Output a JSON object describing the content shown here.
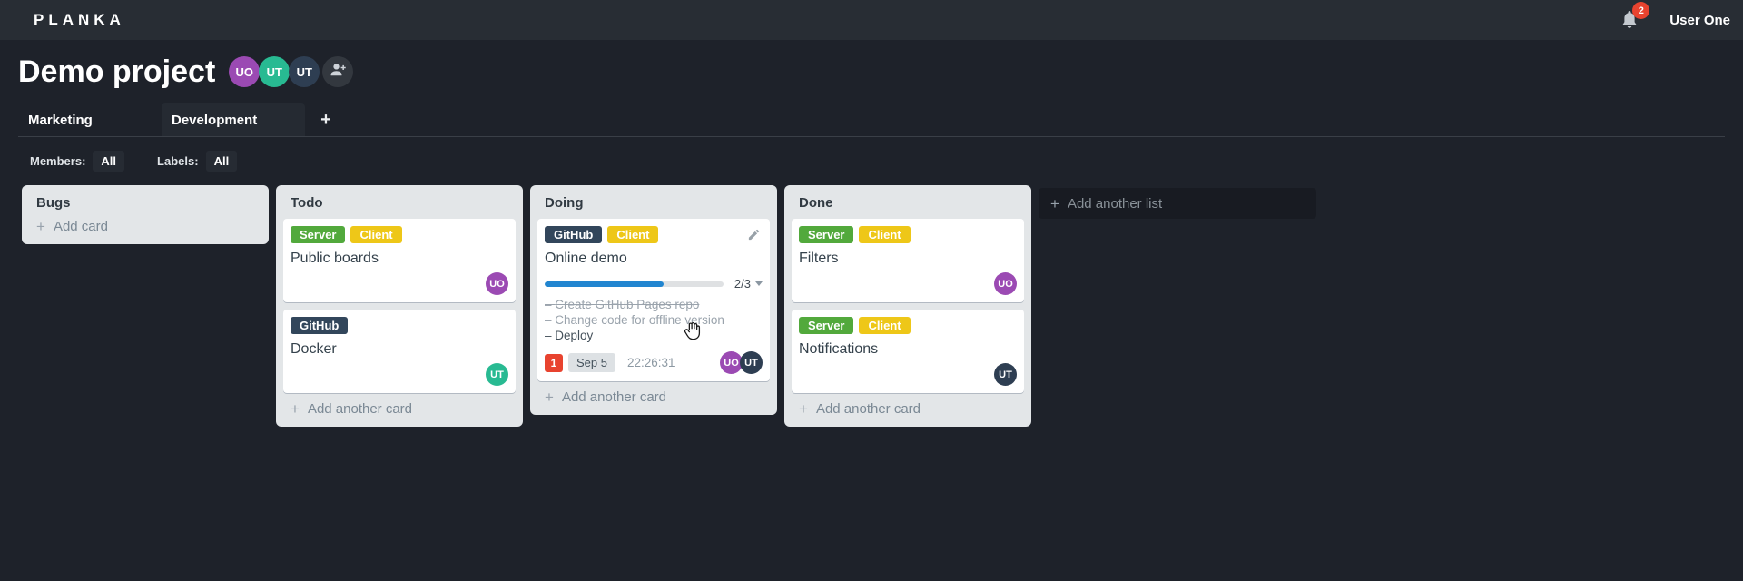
{
  "app": {
    "logo": "PLANKA",
    "user": "User One",
    "notification_count": "2"
  },
  "project": {
    "title": "Demo project",
    "members": [
      {
        "initials": "UO",
        "color": "#9b4ab3"
      },
      {
        "initials": "UT",
        "color": "#28ba92"
      },
      {
        "initials": "UT",
        "color": "#2e3e52"
      }
    ]
  },
  "tabs": {
    "items": [
      {
        "label": "Marketing",
        "active": false
      },
      {
        "label": "Development",
        "active": true
      }
    ],
    "add_label": "+"
  },
  "filters": {
    "members_label": "Members:",
    "members_value": "All",
    "labels_label": "Labels:",
    "labels_value": "All"
  },
  "colors": {
    "label_green": "#52a93c",
    "label_yellow": "#eec718",
    "label_navy": "#32465b",
    "progress_blue": "#2185d0",
    "alert_red": "#e8432f"
  },
  "board": {
    "add_list_label": "Add another list",
    "plus": "+",
    "lists": [
      {
        "name": "Bugs",
        "footer_label": "Add card",
        "cards": []
      },
      {
        "name": "Todo",
        "footer_label": "Add another card",
        "cards": [
          {
            "title": "Public boards",
            "labels": [
              {
                "text": "Server",
                "color": "#52a93c"
              },
              {
                "text": "Client",
                "color": "#eec718"
              }
            ],
            "member": {
              "initials": "UO",
              "color": "#9b4ab3"
            }
          },
          {
            "title": "Docker",
            "labels": [
              {
                "text": "GitHub",
                "color": "#32465b"
              }
            ],
            "member": {
              "initials": "UT",
              "color": "#28ba92"
            }
          }
        ]
      },
      {
        "name": "Doing",
        "footer_label": "Add another card",
        "cards": [
          {
            "title": "Online demo",
            "labels": [
              {
                "text": "GitHub",
                "color": "#32465b"
              },
              {
                "text": "Client",
                "color": "#eec718"
              }
            ],
            "progress": {
              "percent": 66.7,
              "fraction": "2/3"
            },
            "tasks": [
              {
                "text": "Create GitHub Pages repo",
                "done": true
              },
              {
                "text": "Change code for offline version",
                "done": true
              },
              {
                "text": "Deploy",
                "done": false
              }
            ],
            "notification_count": "1",
            "due_date": "Sep 5",
            "timer": "22:26:31",
            "members": [
              {
                "initials": "UO",
                "color": "#9b4ab3"
              },
              {
                "initials": "UT",
                "color": "#2e3e52"
              }
            ]
          }
        ]
      },
      {
        "name": "Done",
        "footer_label": "Add another card",
        "cards": [
          {
            "title": "Filters",
            "labels": [
              {
                "text": "Server",
                "color": "#52a93c"
              },
              {
                "text": "Client",
                "color": "#eec718"
              }
            ],
            "member": {
              "initials": "UO",
              "color": "#9b4ab3"
            }
          },
          {
            "title": "Notifications",
            "labels": [
              {
                "text": "Server",
                "color": "#52a93c"
              },
              {
                "text": "Client",
                "color": "#eec718"
              }
            ],
            "member": {
              "initials": "UT",
              "color": "#2e3e52"
            }
          }
        ]
      }
    ]
  }
}
